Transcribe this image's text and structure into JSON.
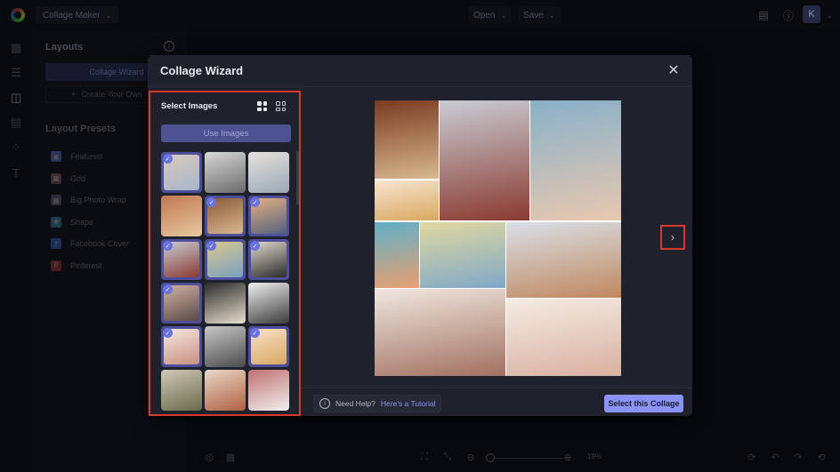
{
  "topbar": {
    "app_title": "Collage Maker",
    "open_label": "Open",
    "save_label": "Save",
    "avatar_initial": "K"
  },
  "sidebar": {
    "title": "Layouts",
    "wizard_label": "Collage Wizard",
    "create_label": "Create Your Own",
    "presets_title": "Layout Presets",
    "presets": [
      {
        "label": "Featured",
        "icon": "featured-icon",
        "color": "#2c3256"
      },
      {
        "label": "Grid",
        "icon": "grid-icon",
        "color": "#3a2a30"
      },
      {
        "label": "Big Photo Wrap",
        "icon": "photo-wrap-icon",
        "color": "#2e2a3a"
      },
      {
        "label": "Shape",
        "icon": "shape-icon",
        "color": "#1c3a4a"
      },
      {
        "label": "Facebook Cover",
        "icon": "facebook-icon",
        "color": "#1c2e58"
      },
      {
        "label": "Pinterest",
        "icon": "pinterest-icon",
        "color": "#4a1c20"
      }
    ]
  },
  "modal": {
    "title": "Collage Wizard",
    "select_images_label": "Select Images",
    "use_images_label": "Use Images",
    "help_text": "Need Help?",
    "help_link": "Here's a Tutorial",
    "select_collage_label": "Select this Collage",
    "thumbnails": [
      {
        "selected": true,
        "colors": [
          "#d8c9c0",
          "#a8b6c8"
        ]
      },
      {
        "selected": false,
        "colors": [
          "#d8d8d8",
          "#6a6a6a"
        ]
      },
      {
        "selected": false,
        "colors": [
          "#e6e2dc",
          "#9aa8b6"
        ]
      },
      {
        "selected": false,
        "colors": [
          "#c07850",
          "#e8c8a0"
        ]
      },
      {
        "selected": true,
        "colors": [
          "#8a5a3a",
          "#d8b890"
        ]
      },
      {
        "selected": true,
        "colors": [
          "#e8b080",
          "#506080"
        ]
      },
      {
        "selected": true,
        "colors": [
          "#c8ccd4",
          "#8a3a30"
        ]
      },
      {
        "selected": true,
        "colors": [
          "#d8c890",
          "#7aa0c0"
        ]
      },
      {
        "selected": true,
        "colors": [
          "#e0d8cc",
          "#2a2a2a"
        ]
      },
      {
        "selected": true,
        "colors": [
          "#d0b0a0",
          "#5a4a48"
        ]
      },
      {
        "selected": false,
        "colors": [
          "#2a2a2a",
          "#e8e0d0"
        ]
      },
      {
        "selected": false,
        "colors": [
          "#f0f0f0",
          "#3a3a3a"
        ]
      },
      {
        "selected": true,
        "colors": [
          "#f4e8e0",
          "#c89080"
        ]
      },
      {
        "selected": false,
        "colors": [
          "#c8c8c8",
          "#4a4a4a"
        ]
      },
      {
        "selected": true,
        "colors": [
          "#f8e0c8",
          "#d8a860"
        ]
      },
      {
        "selected": false,
        "colors": [
          "#d0c8b8",
          "#6a6a4a"
        ]
      },
      {
        "selected": false,
        "colors": [
          "#e8d8c8",
          "#b06040"
        ]
      },
      {
        "selected": false,
        "colors": [
          "#c07070",
          "#f0f0f0"
        ]
      }
    ],
    "collage_tiles": [
      {
        "name": "petra-tile",
        "colors": [
          "#7a3a20",
          "#d8b890"
        ]
      },
      {
        "name": "dream-big-tile",
        "colors": [
          "#f8e4d0",
          "#d8a860"
        ]
      },
      {
        "name": "prague-tile",
        "colors": [
          "#c8ccd4",
          "#8a3a30"
        ]
      },
      {
        "name": "airplane-window-tile",
        "colors": [
          "#8ab0c8",
          "#e8c8b0"
        ]
      },
      {
        "name": "balloons-tile",
        "colors": [
          "#60b0c8",
          "#e8a070"
        ]
      },
      {
        "name": "map-tile",
        "colors": [
          "#e0d8a0",
          "#80a8c8"
        ]
      },
      {
        "name": "photographer-tile",
        "colors": [
          "#d8e0e8",
          "#c08860"
        ]
      },
      {
        "name": "mountain-tile",
        "colors": [
          "#f0e8e0",
          "#a07060"
        ]
      },
      {
        "name": "adventures-tile",
        "colors": [
          "#f4ece4",
          "#d8b0a0"
        ]
      }
    ]
  },
  "bottombar": {
    "zoom_label": "19%"
  }
}
